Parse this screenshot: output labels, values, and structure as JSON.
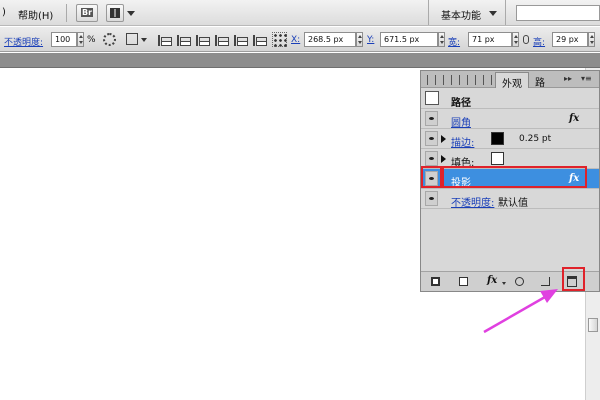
{
  "menubar": {
    "help_menu": "帮助(H)",
    "bridge_label": "Br",
    "workspace": "基本功能"
  },
  "controlbar": {
    "opacity_label": "不透明度:",
    "opacity_value": "100",
    "opacity_unit": "%",
    "x_label": "X:",
    "x_value": "268.5 px",
    "y_label": "Y:",
    "y_value": "671.5 px",
    "w_label": "宽:",
    "w_value": "71 px",
    "h_label": "高:",
    "h_value": "29 px"
  },
  "panel": {
    "tab_label": "外观",
    "tab_other": "路",
    "header": "路径",
    "rows": [
      {
        "label": "圆角"
      },
      {
        "label": "描边:",
        "value": "0.25 pt"
      },
      {
        "label": "填色:"
      },
      {
        "label": "投影"
      },
      {
        "label": "不透明度:",
        "value": "默认值"
      }
    ],
    "fx_symbol": "fx"
  },
  "colors": {
    "selection": "#3d8fe0",
    "highlight": "#e0222a",
    "arrow": "#e040e0",
    "link": "#1a3fb8"
  }
}
